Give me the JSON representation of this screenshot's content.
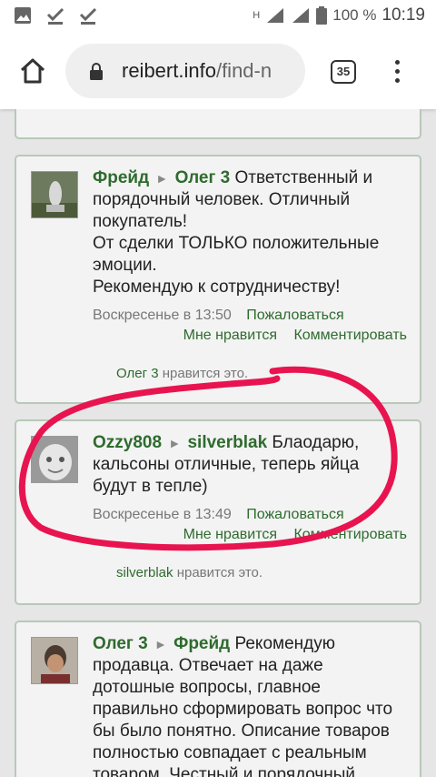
{
  "status_bar": {
    "battery": "100 %",
    "time": "10:19",
    "network": "H"
  },
  "toolbar": {
    "url_domain": "reibert.info",
    "url_path": "/find-n",
    "tab_count": "35"
  },
  "posts": [
    {
      "from": "Фрейд",
      "to": "Олег 3",
      "text_lines": [
        "Ответственный и",
        "порядочный человек. Отличный",
        "покупатель!",
        "От сделки ТОЛЬКО положительные",
        "эмоции.",
        "Рекомендую к сотрудничеству!"
      ],
      "time": "Воскресенье в 13:50",
      "report": "Пожаловаться",
      "like": "Мне нравится",
      "comment": "Комментировать",
      "likes_user": "Олег 3",
      "likes_text": "нравится это."
    },
    {
      "from": "Ozzy808",
      "to": "silverblak",
      "text_lines": [
        "Блаодарю,",
        "кальсоны отличные, теперь яйца",
        "будут в тепле)"
      ],
      "time": "Воскресенье в 13:49",
      "report": "Пожаловаться",
      "like": "Мне нравится",
      "comment": "Комментировать",
      "likes_user": "silverblak",
      "likes_text": "нравится это."
    },
    {
      "from": "Олег 3",
      "to": "Фрейд",
      "text_lines": [
        "Рекомендую",
        "продавца. Отвечает на даже",
        "дотошные вопросы, главное",
        "правильно сформировать вопрос что",
        "бы было понятно. Описание товаров",
        "полностью совпадает с реальным",
        "товаром. Честный и порядочный"
      ]
    }
  ],
  "colors": {
    "user_link": "#2e6b2e",
    "annotation": "#e8144f",
    "card_border": "#b9c8b9"
  }
}
